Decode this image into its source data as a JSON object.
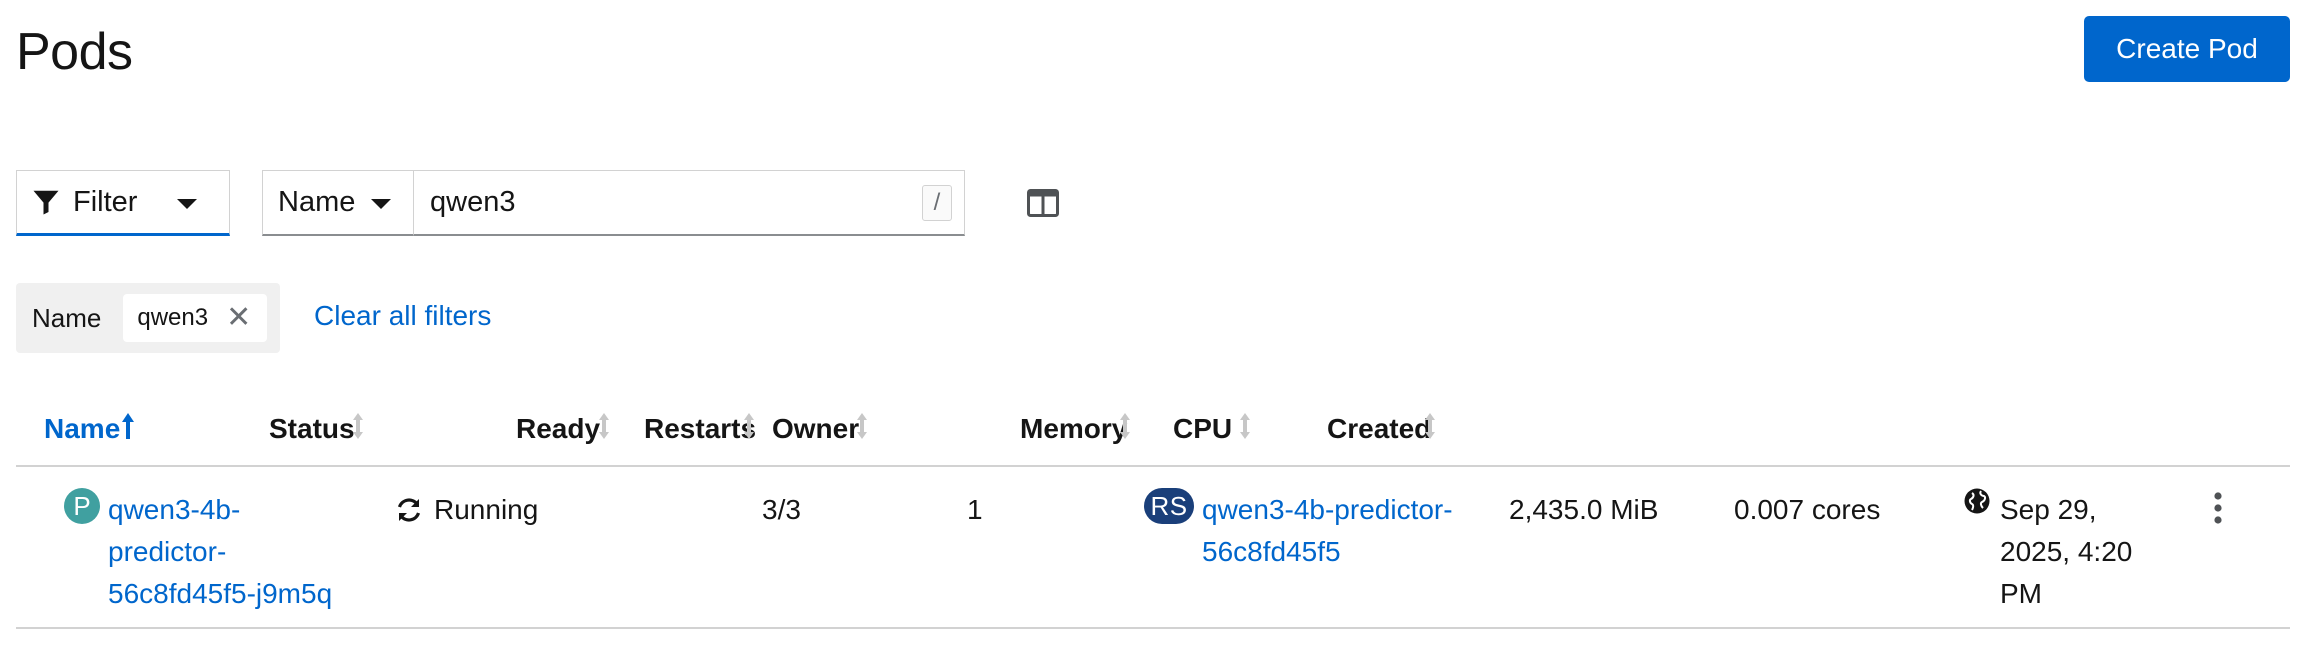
{
  "header": {
    "title": "Pods",
    "create_button": "Create Pod"
  },
  "toolbar": {
    "filter_label": "Filter",
    "filter_type": "Name",
    "search_value": "qwen3",
    "search_shortcut": "/"
  },
  "chips": {
    "category": "Name",
    "value": "qwen3",
    "clear_all": "Clear all filters"
  },
  "table": {
    "columns": [
      "Name",
      "Status",
      "Ready",
      "Restarts",
      "Owner",
      "Memory",
      "CPU",
      "Created"
    ],
    "sorted_column": "Name",
    "rows": [
      {
        "kind_badge": "P",
        "name_lines": [
          "qwen3-4b-",
          "predictor-",
          "56c8fd45f5-j9m5q"
        ],
        "status": "Running",
        "ready": "3/3",
        "restarts": "1",
        "owner_badge": "RS",
        "owner_lines": [
          "qwen3-4b-predictor-",
          "56c8fd45f5"
        ],
        "memory": "2,435.0 MiB",
        "cpu": "0.007 cores",
        "created_lines": [
          "Sep 29,",
          "2025, 4:20",
          "PM"
        ]
      }
    ]
  },
  "colors": {
    "accent": "#0066cc",
    "pod_badge": "#40a0a0",
    "rs_badge": "#1a3f7a"
  }
}
